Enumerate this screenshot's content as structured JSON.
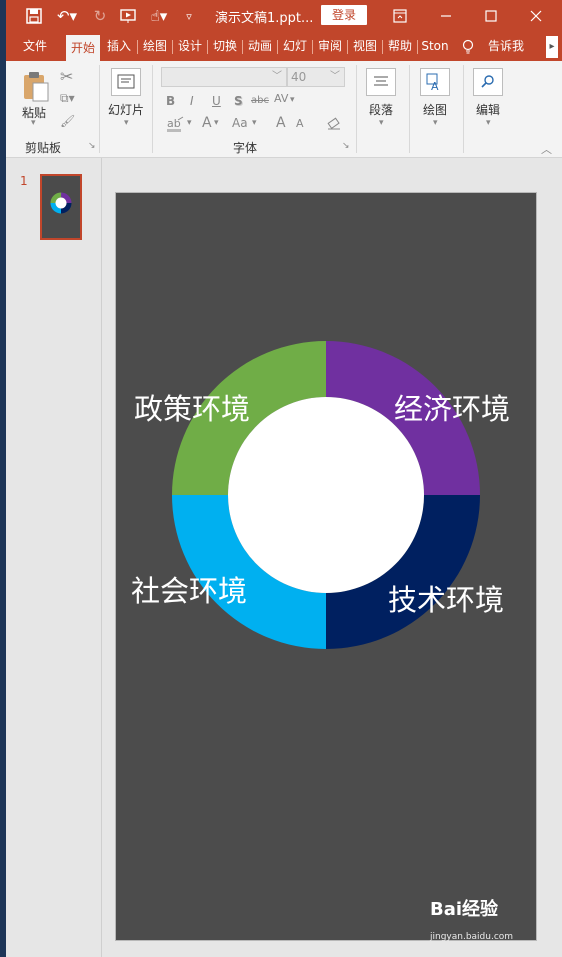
{
  "window": {
    "title": "演示文稿1.ppt...",
    "login_label": "登录"
  },
  "tabs": [
    "文件",
    "开始",
    "插入",
    "绘图",
    "设计",
    "切换",
    "动画",
    "幻灯",
    "审阅",
    "视图",
    "帮助",
    "Ston",
    "告诉我"
  ],
  "active_tab": "开始",
  "ribbon": {
    "paste_label": "粘贴",
    "clipboard_group": "剪贴板",
    "slides_label": "幻灯片",
    "font_size": "40",
    "font_group": "字体",
    "bold": "B",
    "italic": "I",
    "underline": "U",
    "shadow": "S",
    "strike": "abc",
    "spacing": "AV",
    "font_color": "A",
    "change_case": "Aa",
    "grow": "A",
    "shrink": "A",
    "paragraph_label": "段落",
    "drawing_label": "绘图",
    "editing_label": "编辑"
  },
  "thumbnails": {
    "slide_number": "1"
  },
  "slide": {
    "background_color": "#4c4c4c",
    "segments": [
      {
        "label": "政策环境",
        "color": "#70ad47"
      },
      {
        "label": "经济环境",
        "color": "#7030a0"
      },
      {
        "label": "技术环境",
        "color": "#002060"
      },
      {
        "label": "社会环境",
        "color": "#00b0f0"
      }
    ]
  },
  "watermark": {
    "text": "Bai经验",
    "url": "jingyan.baidu.com"
  }
}
